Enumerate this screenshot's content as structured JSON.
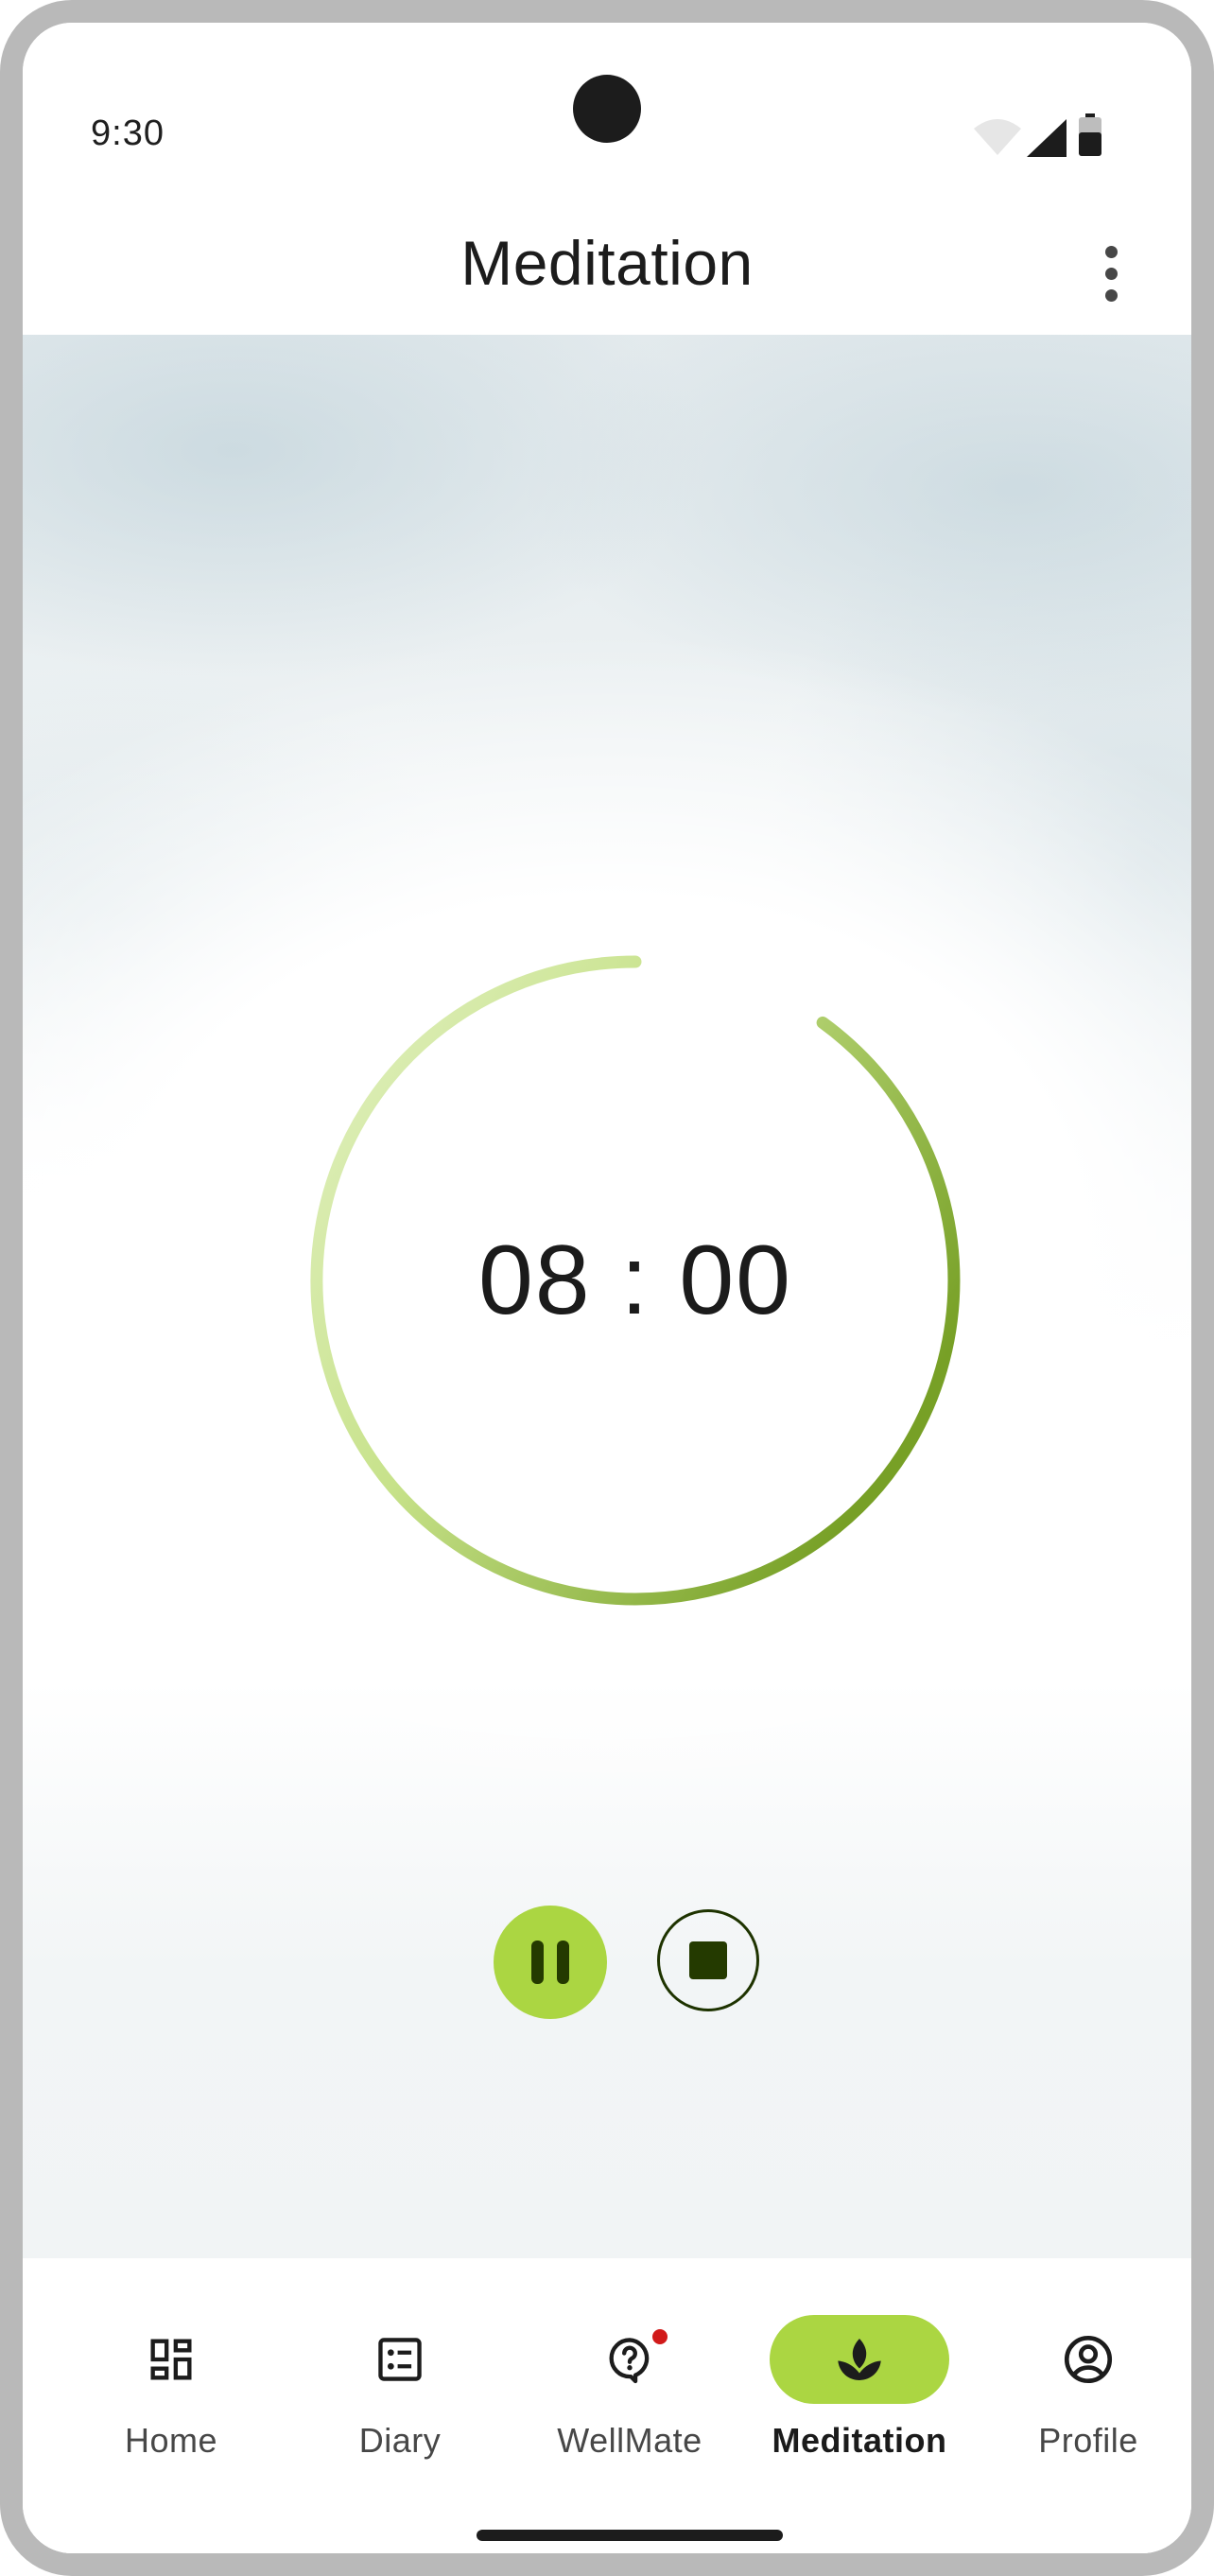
{
  "status_bar": {
    "time": "9:30",
    "icons": [
      "wifi-icon",
      "cellular-signal-icon",
      "battery-icon"
    ]
  },
  "header": {
    "title": "Meditation",
    "menu_icon": "more-vert-icon"
  },
  "timer": {
    "display": "08 : 00",
    "progress_fraction": 0.9,
    "ring_color_start": "#dff0b8",
    "ring_color_end": "#7da52a"
  },
  "controls": {
    "pause_icon": "pause-icon",
    "stop_icon": "stop-icon",
    "pause_color": "#abd642"
  },
  "bottom_nav": {
    "items": [
      {
        "label": "Home",
        "icon": "dashboard-icon",
        "active": false
      },
      {
        "label": "Diary",
        "icon": "list-icon",
        "active": false
      },
      {
        "label": "WellMate",
        "icon": "help-chat-icon",
        "active": false,
        "badge": true
      },
      {
        "label": "Meditation",
        "icon": "spa-icon",
        "active": true
      },
      {
        "label": "Profile",
        "icon": "account-circle-icon",
        "active": false
      }
    ],
    "active_color": "#abd642"
  }
}
